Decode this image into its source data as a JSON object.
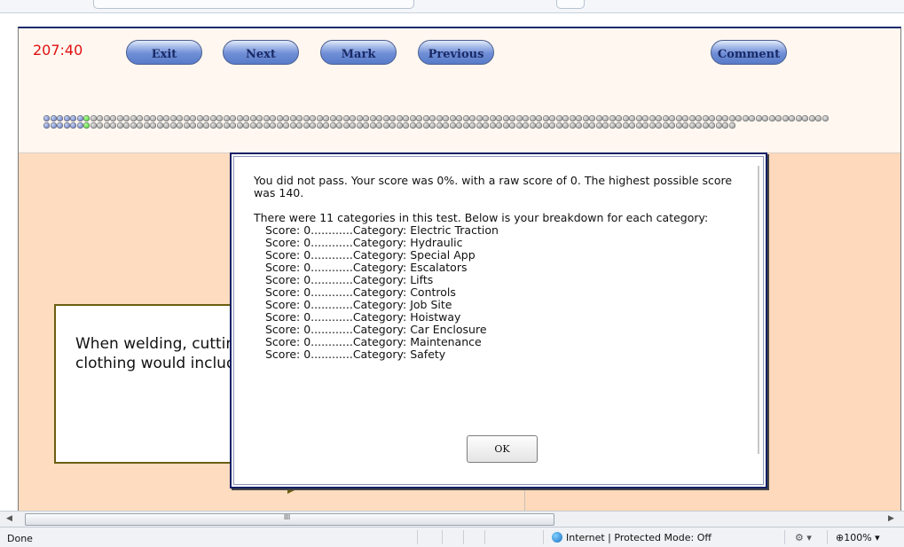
{
  "exam": {
    "timer": "207:40",
    "buttons": {
      "exit": "Exit",
      "next": "Next",
      "mark": "Mark",
      "previous": "Previous",
      "comment": "Comment"
    },
    "progress": {
      "blue_count": 6,
      "current_index": 6,
      "row1_count": 118,
      "row2_count": 104
    }
  },
  "question": {
    "text_line1": "When welding, cutting",
    "text_line2": "clothing would include"
  },
  "result_dialog": {
    "summary": "You did not pass. Your  score was  0%. with a raw score of  0. The highest possible score was 140.",
    "breakdown_intro": "There were 11 categories in this test. Below is your breakdown for each category:",
    "categories": [
      "Score: 0............Category: Electric Traction",
      "Score: 0............Category: Hydraulic",
      "Score: 0............Category: Special App",
      "Score: 0............Category: Escalators",
      "Score: 0............Category: Lifts",
      "Score: 0............Category: Controls",
      "Score: 0............Category: Job Site",
      "Score: 0............Category: Hoistway",
      "Score: 0............Category: Car Enclosure",
      "Score: 0............Category: Maintenance",
      "Score: 0............Category: Safety"
    ],
    "ok_label": "OK"
  },
  "browser": {
    "status_left": "Done",
    "zone": "Internet | Protected Mode: Off",
    "zoom": "100%",
    "hscroll_grip": "III",
    "icons": [
      "globe-icon",
      "security-icon",
      "zoom-icon",
      "scroll-left-arrow-icon",
      "scroll-right-arrow-icon"
    ]
  },
  "colors": {
    "timer": "#e01010",
    "button_blue": "#6f8ed6",
    "dialog_border": "#131f66",
    "progress_answered": "#5068b4",
    "progress_current": "#2fbf22",
    "page_background": "#ffd9bb"
  }
}
